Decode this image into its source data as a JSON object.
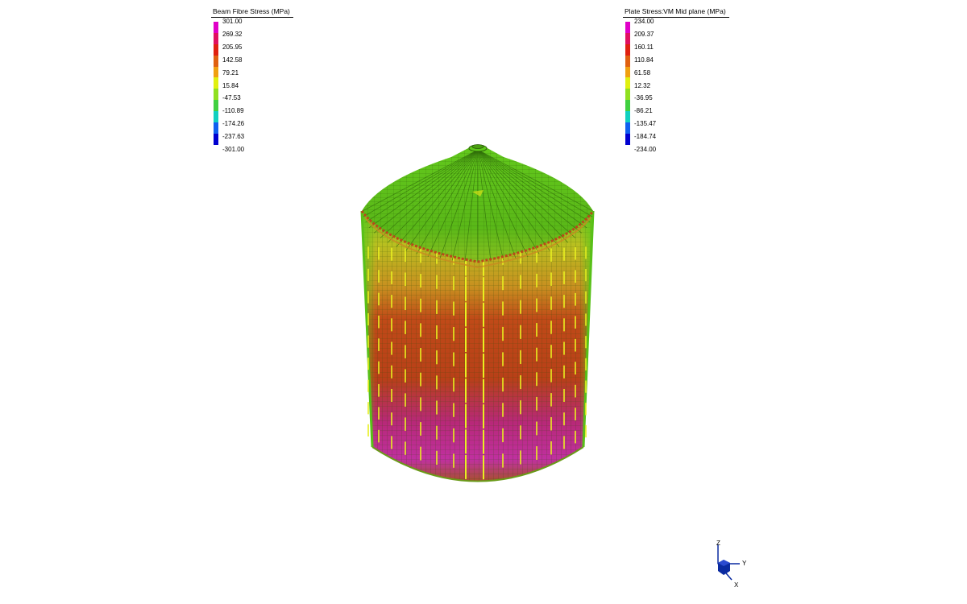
{
  "legends": {
    "beam": {
      "title": "Beam Fibre Stress  (MPa)",
      "ticks": [
        "301.00",
        "269.32",
        "205.95",
        "142.58",
        "79.21",
        "15.84",
        "-47.53",
        "-110.89",
        "-174.26",
        "-237.63",
        "-301.00"
      ]
    },
    "plate": {
      "title": "Plate Stress:VM Mid plane  (MPa)",
      "ticks": [
        "234.00",
        "209.37",
        "160.11",
        "110.84",
        "61.58",
        "12.32",
        "-36.95",
        "-86.21",
        "-135.47",
        "-184.74",
        "-234.00"
      ]
    },
    "colors": [
      "#e000c8",
      "#e01060",
      "#e02010",
      "#e06010",
      "#f0a010",
      "#e0f010",
      "#90e020",
      "#40d040",
      "#10d0c0",
      "#1060f0",
      "#0000d0"
    ]
  },
  "model": {
    "shell_colors": {
      "roof": "#5ec81a",
      "roof_ring": "#b84a1a",
      "upper_band": "#b8c020",
      "mid_band": "#c04a18",
      "lower_band": "#b82878",
      "grid_line": "#3a5a10",
      "stiffener": "#e8f020"
    }
  },
  "triad": {
    "z_label": "Z",
    "y_label": "Y",
    "x_label": "X",
    "color": "#0a2aa0"
  }
}
